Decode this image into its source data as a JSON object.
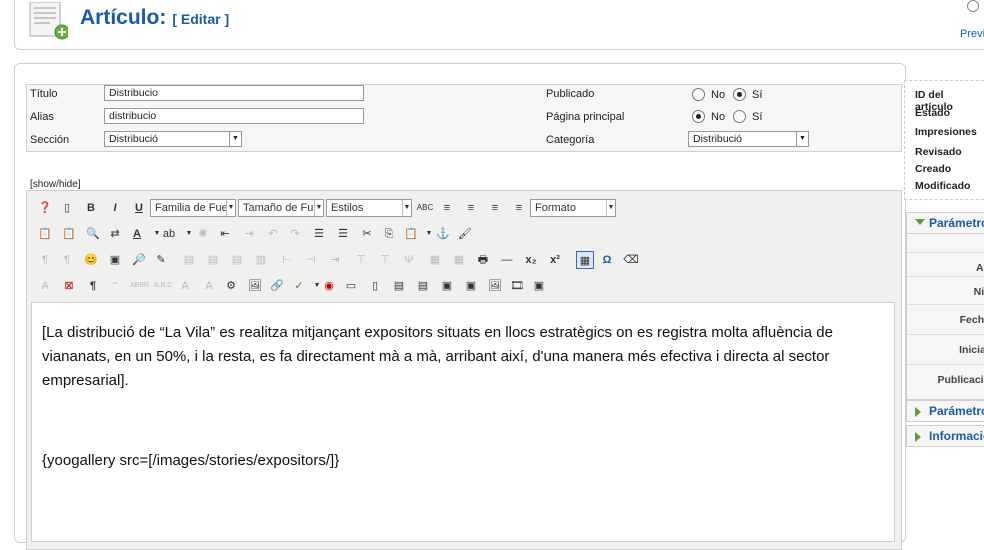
{
  "header": {
    "title": "Artículo:",
    "edit_label": "[ Editar ]",
    "preview_label": "Previ"
  },
  "form": {
    "titulo_label": "Título",
    "titulo_value": "Distribucio",
    "alias_label": "Alias",
    "alias_value": "distribucio",
    "seccion_label": "Sección",
    "seccion_value": "Distribució",
    "publicado_label": "Publicado",
    "pagina_label": "Página principal",
    "categoria_label": "Categoría",
    "categoria_value": "Distribució",
    "no_label": "No",
    "si_label": "Sí"
  },
  "editor": {
    "showhide": "[show/hide]",
    "font_family": "Familia de Fue",
    "font_size": "Tamaño de Fu",
    "styles": "Estilos",
    "format": "Formato",
    "paragraph1": "[La distribució de “La Vila” es realitza mitjançant expositors situats en llocs estratègics on es registra molta afluència de viananats, en un 50%, i la resta, es fa directament mà a mà, arribant així, d'una manera més efectiva i directa al sector empresarial].",
    "paragraph2": "{yoogallery src=[/images/stories/expositors/]}"
  },
  "sidebar": {
    "id_label": "ID del artículo",
    "estado": "Estado",
    "impresiones": "Impresiones",
    "revisado": "Revisado",
    "creado": "Creado",
    "modificado": "Modificado",
    "params1": "Parámetros",
    "rows": [
      "Au",
      "Niv",
      "Fecha",
      "Iniciar",
      "Publicació"
    ],
    "params2": "Parámetros",
    "info": "Información"
  },
  "colors": {
    "accent": "#1a5ba8",
    "toggle": "#5a9e3a"
  }
}
